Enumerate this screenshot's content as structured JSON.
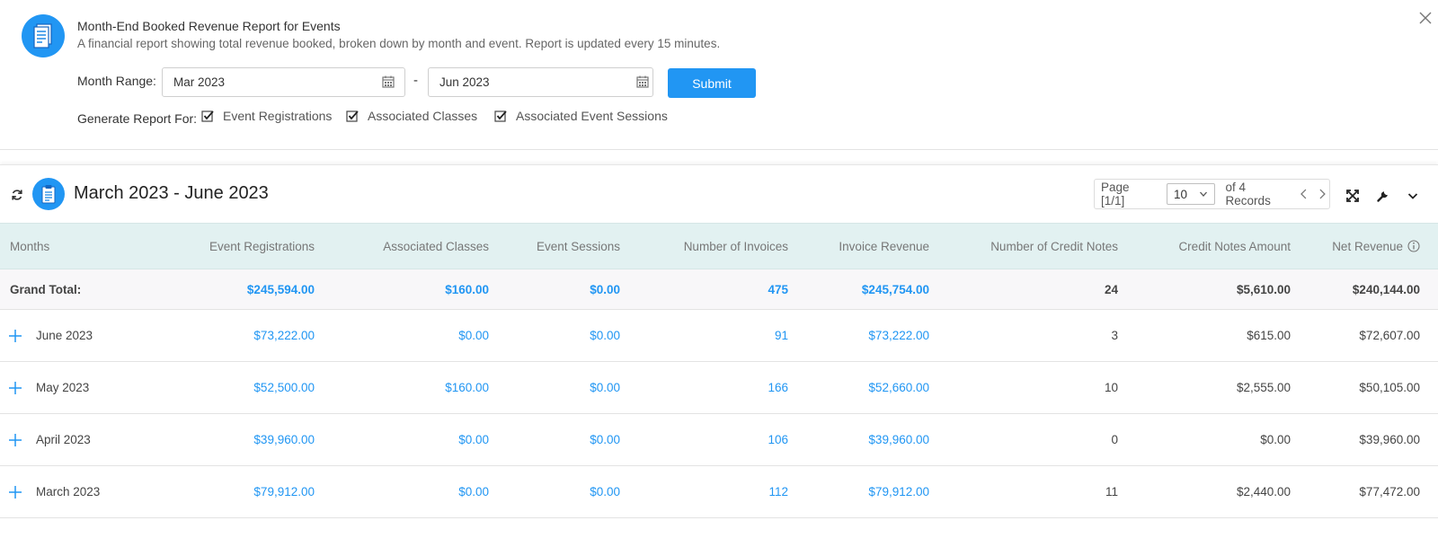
{
  "header": {
    "title": "Month-End Booked Revenue Report for Events",
    "description": "A financial report showing total revenue booked, broken down by month and event. Report is updated every 15 minutes.",
    "range_label": "Month Range:",
    "from_value": "Mar 2023",
    "to_value": "Jun 2023",
    "range_separator": "-",
    "submit_label": "Submit",
    "generate_label": "Generate Report For:",
    "options": [
      {
        "label": "Event Registrations",
        "checked": true
      },
      {
        "label": "Associated Classes",
        "checked": true
      },
      {
        "label": "Associated Event Sessions",
        "checked": true
      }
    ]
  },
  "report": {
    "title": "March 2023 - June 2023",
    "pager": {
      "page_info": "Page [1/1]",
      "per_page": "10",
      "records": "of 4 Records"
    },
    "columns": [
      "Months",
      "Event Registrations",
      "Associated Classes",
      "Event Sessions",
      "Number of Invoices",
      "Invoice Revenue",
      "Number of Credit Notes",
      "Credit Notes Amount",
      "Net Revenue"
    ],
    "grand_total": {
      "label": "Grand Total:",
      "event_registrations": "$245,594.00",
      "associated_classes": "$160.00",
      "event_sessions": "$0.00",
      "invoices": "475",
      "invoice_revenue": "$245,754.00",
      "credit_notes": "24",
      "credit_amount": "$5,610.00",
      "net_revenue": "$240,144.00"
    },
    "rows": [
      {
        "month": "June 2023",
        "event_registrations": "$73,222.00",
        "associated_classes": "$0.00",
        "event_sessions": "$0.00",
        "invoices": "91",
        "invoice_revenue": "$73,222.00",
        "credit_notes": "3",
        "credit_amount": "$615.00",
        "net_revenue": "$72,607.00"
      },
      {
        "month": "May 2023",
        "event_registrations": "$52,500.00",
        "associated_classes": "$160.00",
        "event_sessions": "$0.00",
        "invoices": "166",
        "invoice_revenue": "$52,660.00",
        "credit_notes": "10",
        "credit_amount": "$2,555.00",
        "net_revenue": "$50,105.00"
      },
      {
        "month": "April 2023",
        "event_registrations": "$39,960.00",
        "associated_classes": "$0.00",
        "event_sessions": "$0.00",
        "invoices": "106",
        "invoice_revenue": "$39,960.00",
        "credit_notes": "0",
        "credit_amount": "$0.00",
        "net_revenue": "$39,960.00"
      },
      {
        "month": "March 2023",
        "event_registrations": "$79,912.00",
        "associated_classes": "$0.00",
        "event_sessions": "$0.00",
        "invoices": "112",
        "invoice_revenue": "$79,912.00",
        "credit_notes": "11",
        "credit_amount": "$2,440.00",
        "net_revenue": "$77,472.00"
      }
    ]
  },
  "icons": {
    "report": "report-document-icon",
    "close": "close-icon",
    "calendar": "calendar-icon",
    "checkbox": "checkbox-checked-icon",
    "refresh": "refresh-icon",
    "section": "clipboard-icon",
    "expand": "expand-icon",
    "wrench": "wrench-icon",
    "collapse": "chevron-down-icon",
    "info": "info-icon",
    "row_expand": "plus-icon"
  },
  "colors": {
    "accent": "#2196f3",
    "header_bg": "#e2f1f1",
    "total_bg": "#f8f7f9"
  }
}
